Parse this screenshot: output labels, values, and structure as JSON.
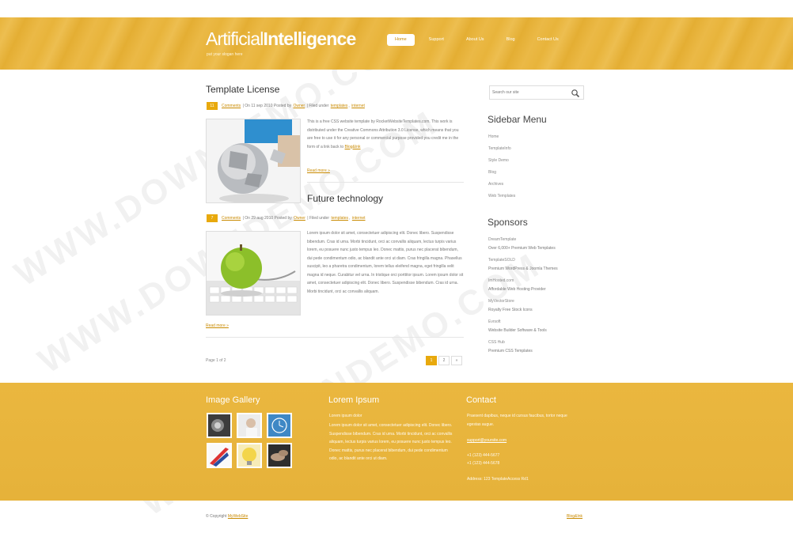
{
  "header": {
    "logo_part1": "Artificial",
    "logo_part2": "Intelligence",
    "slogan": "put your slogan here",
    "nav": [
      "Home",
      "Support",
      "About Us",
      "Blog",
      "Contact Us"
    ]
  },
  "posts": [
    {
      "title": "Template License",
      "comment_count": "11",
      "comments_label": "Comments",
      "date_text": "On 11 sep 2010 Posted by",
      "author": "Owner",
      "filed_label": "Filed under",
      "tag1": "templates",
      "tag2": "internet",
      "body": "This is a free CSS website template by RocketWebsiteTemplates.com. This work is distributed under the Creative Commons Attribution 3.0 License, which means that you are free to use it for any personal or commercial purpose provided you credit me in the form of a link back to",
      "body_link": "Blog&Ink",
      "read_more": "Read more »"
    },
    {
      "title": "Future technology",
      "comment_count": "7",
      "comments_label": "Comments",
      "date_text": "On 29 aug 2010 Posted by",
      "author": "Owner",
      "filed_label": "Filed under",
      "tag1": "templates",
      "tag2": "internet",
      "body": "Lorem ipsum dolor sit amet, consectetuer adipiscing elit. Donec libero. Suspendisse bibendum. Cras id urna. Morbi tincidunt, orci ac convallis aliquam, lectus turpis varius lorem, eu posuere nunc justo tempus leo. Donec mattis, purus nec placerat bibendum, dui pede condimentum odio, ac blandit ante orci ut diam. Cras fringilla magna. Phasellus suscipit, leo a pharetra condimentum, lorem tellus eleifend magna, eget fringilla velit magna id neque. Curabitur vel urna. In tristique orci porttitor ipsum. Lorem ipsum dolor sit amet, consectetuer adipiscing elit. Donec libero. Suspendisse bibendum. Cras id urna. Morbi tincidunt, orci ac convallis aliquam.",
      "read_more": "Read more »"
    }
  ],
  "pagination": {
    "info": "Page 1 of 2",
    "pages": [
      "1",
      "2",
      "»"
    ]
  },
  "sidebar": {
    "search_placeholder": "Search our site",
    "menu_title": "Sidebar Menu",
    "menu": [
      "Home",
      "TemplateInfo",
      "Style Demo",
      "Blog",
      "Archives",
      "Web Templates"
    ],
    "sponsors_title": "Sponsors",
    "sponsors": [
      {
        "name": "DreamTemplate",
        "desc": "Over 6,000+ Premium Web Templates"
      },
      {
        "name": "TemplateSOLD",
        "desc": "Premium WordPress & Joomla Themes"
      },
      {
        "name": "ImHosted.com",
        "desc": "Affordable Web Hosting Provider"
      },
      {
        "name": "MyVectorStore",
        "desc": "Royalty Free Stock Icons"
      },
      {
        "name": "Evrsoft",
        "desc": "Website Builder Software & Tools"
      },
      {
        "name": "CSS Hub",
        "desc": "Premium CSS Templates"
      }
    ]
  },
  "footer": {
    "gallery_title": "Image Gallery",
    "lorem_title": "Lorem Ipsum",
    "lorem_intro": "Lorem ipsum dolor",
    "lorem_body": "Lorem ipsum dolor sit amet, consectetuer adipiscing elit. Donec libero. Suspendisse bibendum. Cras id urna. Morbi tincidunt, orci ac convallis aliquam, lectus turpis varius lorem, eu posuere nunc justo tempus leo. Donec mattis, purus nec placerat bibendum, dui pede condimentum odio, ac blandit ante orci ut diam.",
    "contact_title": "Contact",
    "contact_text": "Praesent dapibus, neque id cursus faucibus, tortor neque egestas augue.",
    "email": "support@yoursite.com",
    "phone1": "+1 (123) 444-5677",
    "phone2": "+1 (123) 444-5678",
    "address": "Address: 123 TemplateAccess Rd1"
  },
  "bottom": {
    "copyright_text": "© Copyright",
    "copyright_link": "MyWebSite",
    "w3c": "Blog&Ink"
  },
  "watermark": "WWW.DOWNDEMO.COM",
  "colors": {
    "accent": "#e8a90d",
    "header_band": "#e8b43b",
    "footer_band": "#e6b23a",
    "link": "#c98a00"
  }
}
